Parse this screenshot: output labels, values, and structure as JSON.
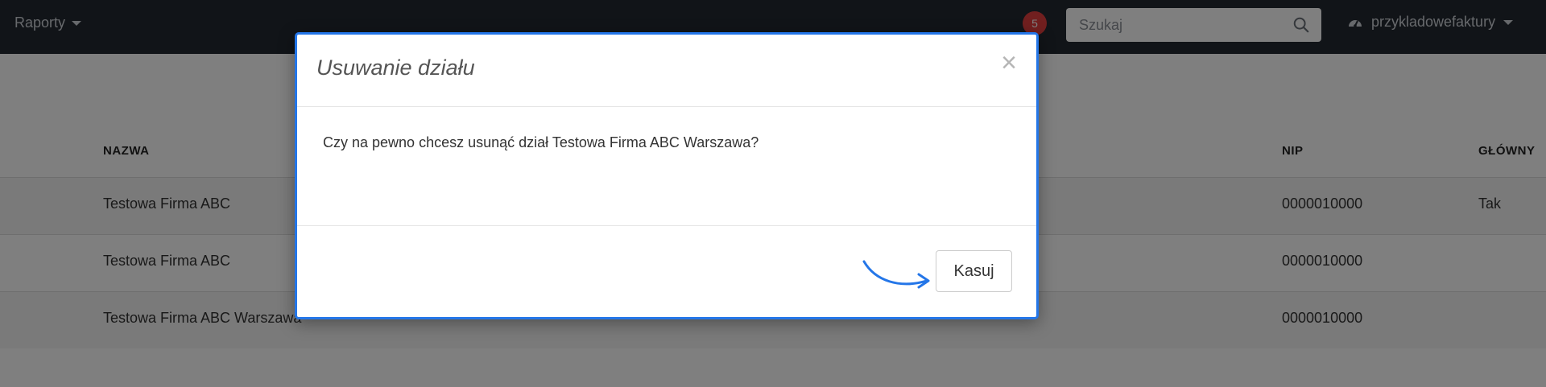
{
  "navbar": {
    "menu_label": "Raporty",
    "notification_count": "5",
    "search_placeholder": "Szukaj",
    "account_label": "przykladowefaktury"
  },
  "table": {
    "headers": [
      "NAZWA",
      "NIP",
      "GŁÓWNY"
    ],
    "rows": [
      {
        "nazwa": "Testowa Firma ABC",
        "nip": "0000010000",
        "glowny": "Tak"
      },
      {
        "nazwa": "Testowa Firma ABC",
        "nip": "0000010000",
        "glowny": ""
      },
      {
        "nazwa": "Testowa Firma ABC Warszawa",
        "nip": "0000010000",
        "glowny": ""
      }
    ]
  },
  "modal": {
    "title": "Usuwanie działu",
    "close_symbol": "×",
    "message": "Czy na pewno chcesz usunąć dział Testowa Firma ABC Warszawa?",
    "confirm_label": "Kasuj"
  },
  "colors": {
    "navbar_bg": "#222831",
    "modal_border": "#2476e8",
    "badge": "#e23f3f"
  }
}
